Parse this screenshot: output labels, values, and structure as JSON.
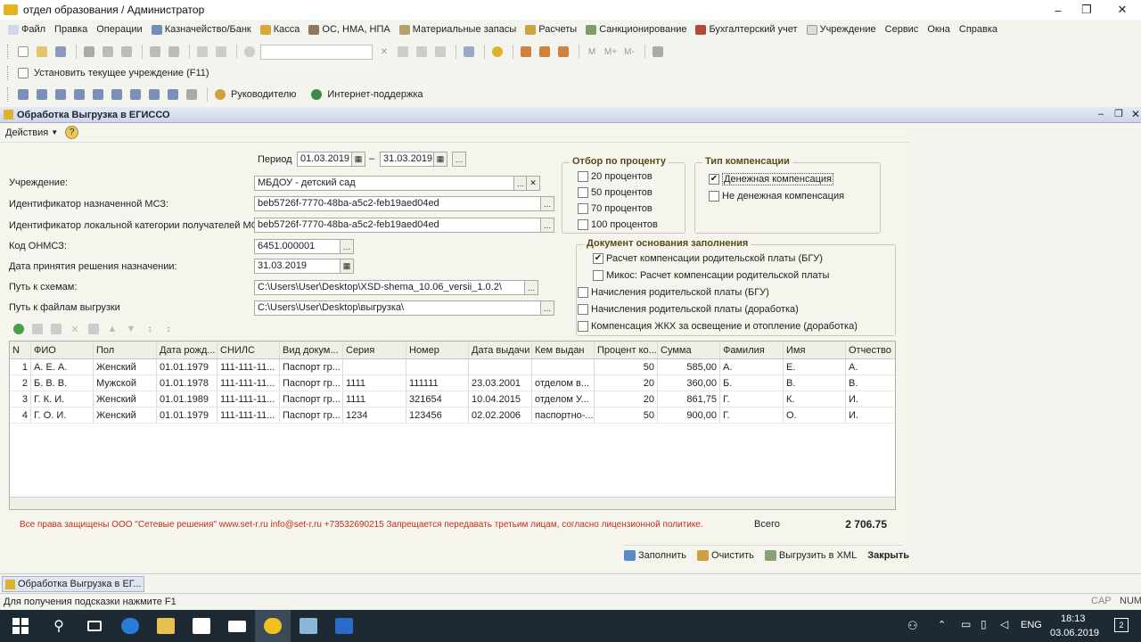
{
  "window": {
    "title": "отдел образования / Администратор",
    "minimize": "–",
    "restore": "❐",
    "close": "✕"
  },
  "menu": [
    "Файл",
    "Правка",
    "Операции",
    "Казначейство/Банк",
    "Касса",
    "ОС, НМА, НПА",
    "Материальные запасы",
    "Расчеты",
    "Санкционирование",
    "Бухгалтерский учет",
    "Учреждение",
    "Сервис",
    "Окна",
    "Справка"
  ],
  "toolbar3": {
    "set_institution": "Установить текущее учреждение (F11)"
  },
  "toolbar4": {
    "manager": "Руководителю",
    "internet": "Интернет-поддержка"
  },
  "doc": {
    "title": "Обработка  Выгрузка в ЕГИССО",
    "actions": "Действия",
    "period_label": "Период",
    "period_from": "01.03.2019",
    "period_dash": "–",
    "period_to": "31.03.2019",
    "institution_label": "Учреждение:",
    "institution_value": "МБДОУ - детский сад",
    "msz_id_label": "Идентификатор назначенной МСЗ:",
    "msz_id_value": "beb5726f-7770-48ba-a5c2-feb19aed04ed",
    "local_cat_label": "Идентификатор локальной категории получателей МСЗ:",
    "local_cat_value": "beb5726f-7770-48ba-a5c2-feb19aed04ed",
    "onmsz_label": "Код ОНМСЗ:",
    "onmsz_value": "6451.000001",
    "decision_date_label": "Дата принятия решения назначении:",
    "decision_date_value": "31.03.2019",
    "schema_path_label": "Путь к схемам:",
    "schema_path_value": "C:\\Users\\User\\Desktop\\XSD-shema_10.06_versii_1.0.2\\",
    "export_path_label": "Путь к файлам выгрузки",
    "export_path_value": "C:\\Users\\User\\Desktop\\выгрузка\\"
  },
  "percent_filter": {
    "title": "Отбор по проценту",
    "items": [
      {
        "label": "20 процентов",
        "checked": false
      },
      {
        "label": "50 процентов",
        "checked": false
      },
      {
        "label": "70 процентов",
        "checked": false
      },
      {
        "label": "100 процентов",
        "checked": false
      }
    ]
  },
  "compensation_type": {
    "title": "Тип компенсации",
    "items": [
      {
        "label": "Денежная компенсация",
        "checked": true
      },
      {
        "label": "Не денежная компенсация",
        "checked": false
      }
    ]
  },
  "basis_doc": {
    "title": "Документ основания заполнения",
    "items": [
      {
        "label": "Расчет компенсации родительской платы (БГУ)",
        "checked": true
      },
      {
        "label": "Микос: Расчет компенсации родительской платы",
        "checked": false
      },
      {
        "label": "Начисления родительской платы (БГУ)",
        "checked": false
      },
      {
        "label": "Начисления  родительской платы (доработка)",
        "checked": false
      },
      {
        "label": "Компенсация ЖКХ за освещение и отопление (доработка)",
        "checked": false
      }
    ]
  },
  "table": {
    "columns": [
      "N",
      "ФИО",
      "Пол",
      "Дата рожд...",
      "СНИЛС",
      "Вид докум...",
      "Серия",
      "Номер",
      "Дата выдачи",
      "Кем выдан",
      "Процент ко...",
      "Сумма",
      "Фамилия",
      "Имя",
      "Отчество"
    ],
    "rows": [
      [
        "1",
        "А. Е. А.",
        "Женский",
        "01.01.1979",
        "111-111-11...",
        "Паспорт гр...",
        "",
        "",
        "",
        "",
        "50",
        "585,00",
        "А.",
        "Е.",
        "А."
      ],
      [
        "2",
        "Б. В. В.",
        "Мужской",
        "01.01.1978",
        "111-111-11...",
        "Паспорт гр...",
        "1111",
        "111111",
        "23.03.2001",
        "отделом в...",
        "20",
        "360,00",
        "Б.",
        "В.",
        "В."
      ],
      [
        "3",
        "Г. К. И.",
        "Женский",
        "01.01.1989",
        "111-111-11...",
        "Паспорт гр...",
        "1111",
        "321654",
        "10.04.2015",
        "отделом У...",
        "20",
        "861,75",
        "Г.",
        "К.",
        "И."
      ],
      [
        "4",
        "Г. О. И.",
        "Женский",
        "01.01.1979",
        "111-111-11...",
        "Паспорт гр...",
        "1234",
        "123456",
        "02.02.2006",
        "паспортно-...",
        "50",
        "900,00",
        "Г.",
        "О.",
        "И."
      ]
    ]
  },
  "footer": {
    "copyright": "Все права защищены ООО \"Сетевые решения\" www.set-r.ru  info@set-r.ru +73532690215 Запрещается передавать третьим лицам, согласно лицензионной политике.",
    "total_label": "Всего",
    "total_value": "2 706.75",
    "fill": "Заполнить",
    "clear": "Очистить",
    "export_xml": "Выгрузить в XML",
    "close": "Закрыть"
  },
  "window_tab": "Обработка  Выгрузка в ЕГ...",
  "status": {
    "hint": "Для получения подсказки нажмите F1",
    "cap": "CAP",
    "num": "NUM"
  },
  "taskbar": {
    "lang": "ENG",
    "time": "18:13",
    "date": "03.06.2019",
    "notif": "2"
  },
  "colors": {
    "menubar": "#f4f4ee",
    "doc_title_bg": "#ccd6ea",
    "notice_red": "#c0301a",
    "taskbar": "#1e2a33"
  }
}
